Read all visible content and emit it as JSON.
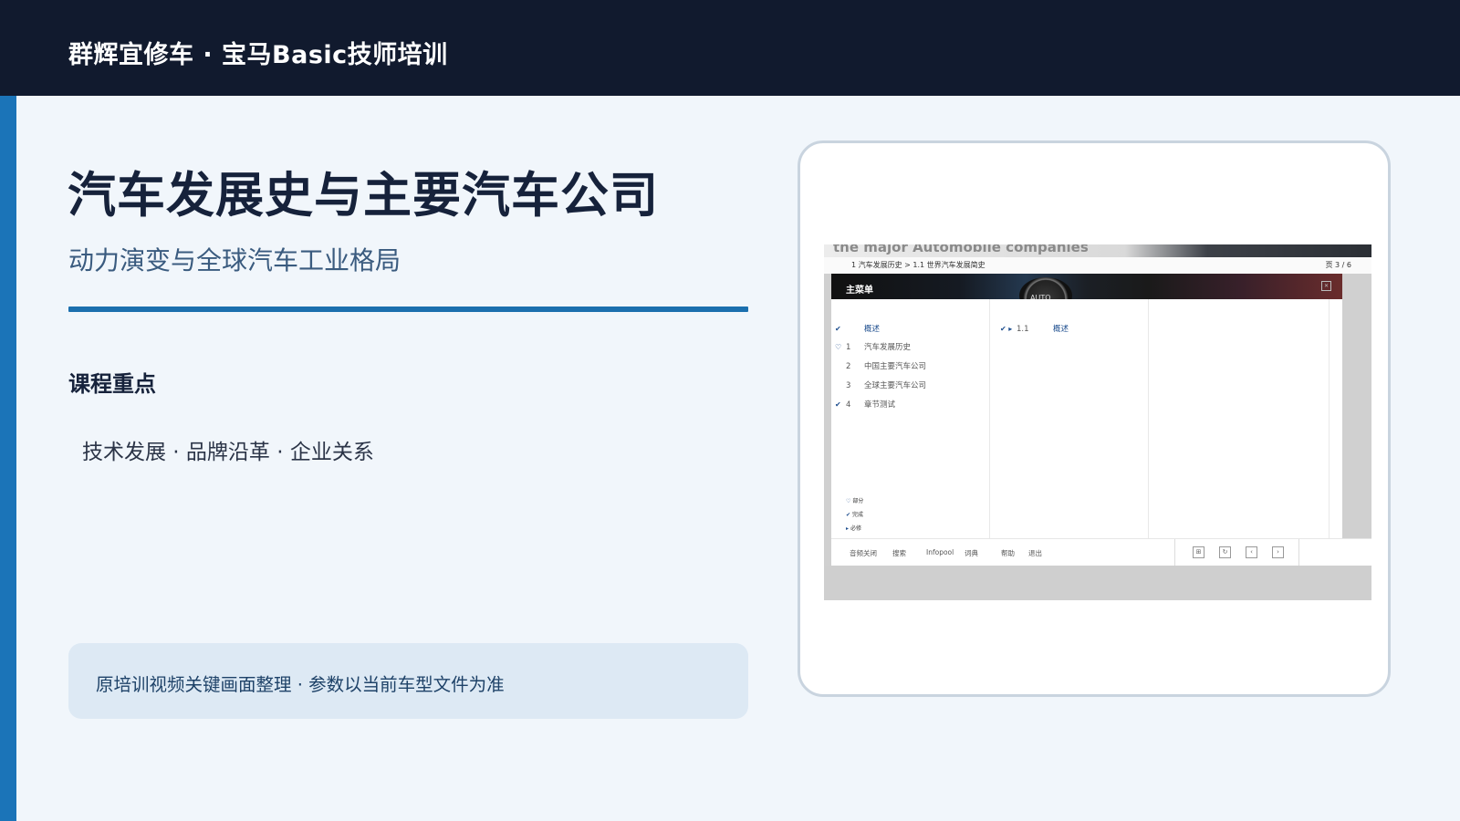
{
  "header": {
    "brand": "群辉宜修车 · 宝马Basic技师培训"
  },
  "slide": {
    "title": "汽车发展史与主要汽车公司",
    "subtitle": "动力演变与全球汽车工业格局",
    "section_label": "课程重点",
    "section_body": "技术发展 · 品牌沿革 · 企业关系",
    "note": "原培训视频关键画面整理 · 参数以当前车型文件为准"
  },
  "screenshot": {
    "header_text": "the major Automobile companies",
    "breadcrumb": "1 汽车发展历史  >  1.1 世界汽车发展简史",
    "page_indicator": "页  3 / 6",
    "menu_title": "主菜单",
    "dial_text": "AUTO",
    "close_icon": "close-icon",
    "left_items": [
      {
        "check": "✔",
        "num": "",
        "label": "概述"
      },
      {
        "check": "♡",
        "num": "1",
        "label": "汽车发展历史"
      },
      {
        "check": "",
        "num": "2",
        "label": "中国主要汽车公司"
      },
      {
        "check": "",
        "num": "3",
        "label": "全球主要汽车公司"
      },
      {
        "check": "✔",
        "num": "4",
        "label": "章节测试"
      }
    ],
    "mid_items": [
      {
        "check": "✔ ▸",
        "num": "1.1",
        "label": "概述"
      }
    ],
    "legend": [
      {
        "mark": "♡",
        "label": "部分"
      },
      {
        "mark": "✔",
        "label": "完成"
      },
      {
        "mark": "▸",
        "label": "必修"
      }
    ],
    "footer": [
      "音频关闭",
      "搜索",
      "Infopool",
      "词典",
      "帮助",
      "退出"
    ],
    "nav_icons": [
      "fullscreen-icon",
      "refresh-icon",
      "prev-icon",
      "next-icon"
    ]
  },
  "colors": {
    "header_bg": "#111a2e",
    "accent": "#1b74b8",
    "page_bg": "#f1f6fb",
    "note_bg": "#dde9f4"
  }
}
